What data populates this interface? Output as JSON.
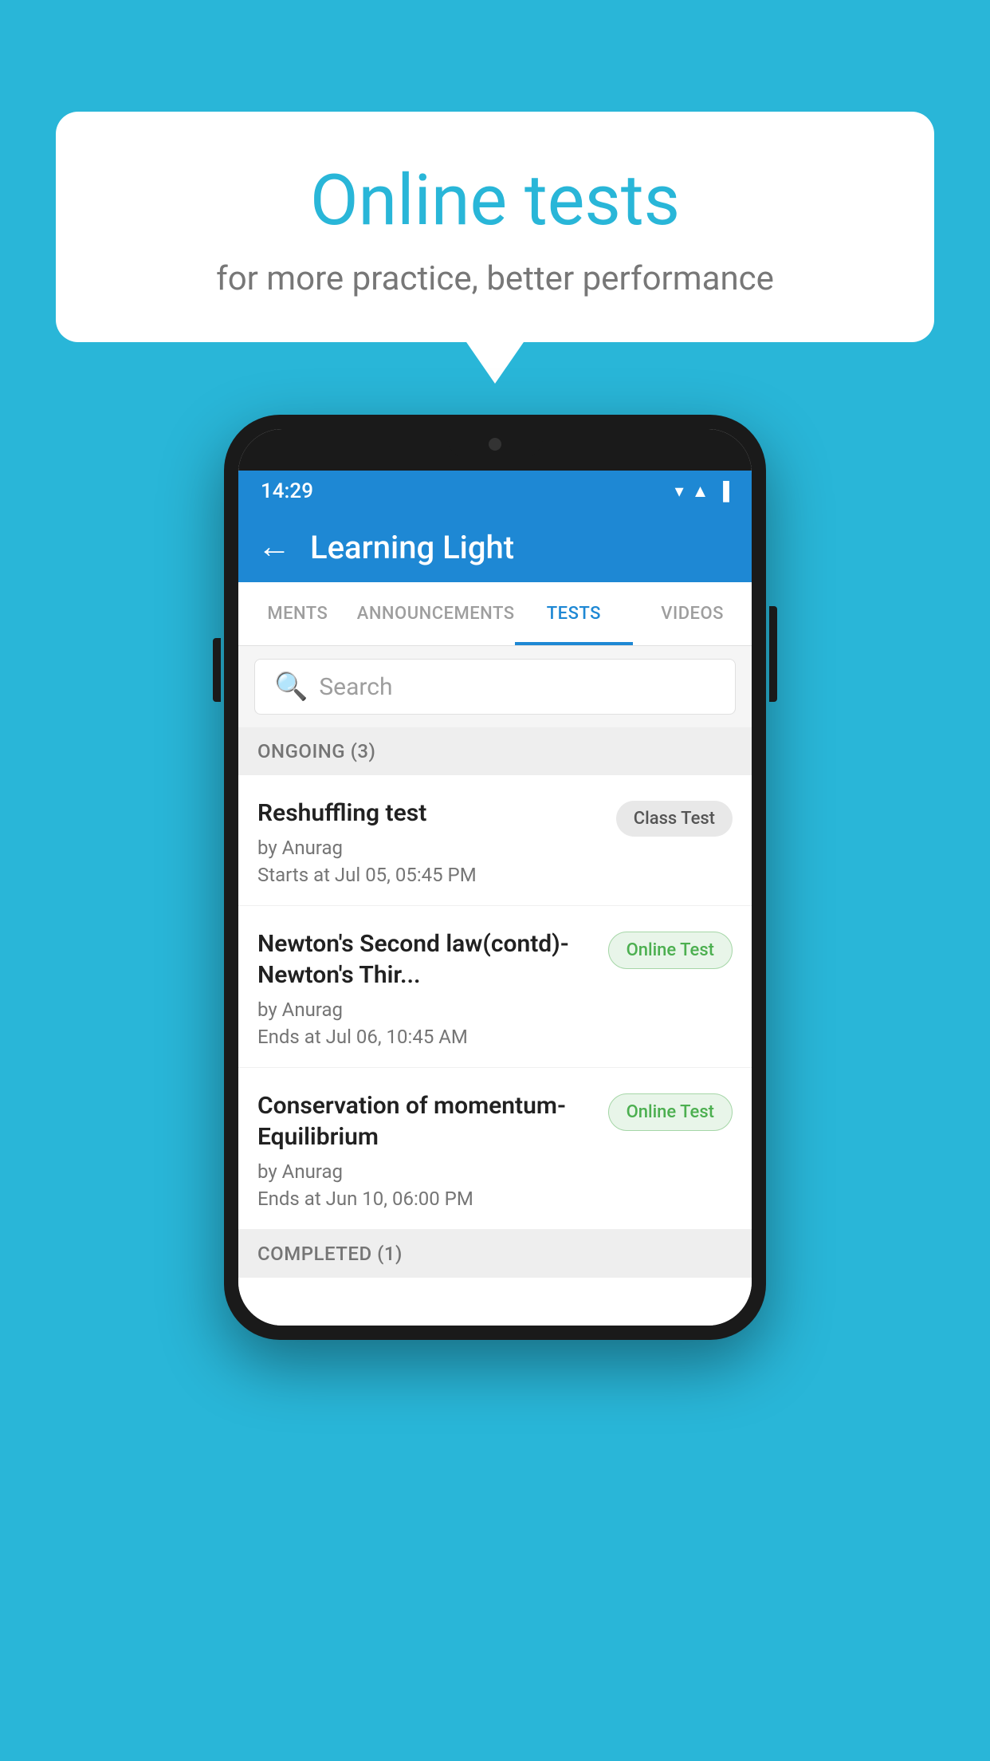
{
  "background": {
    "color": "#29b6d8"
  },
  "speech_bubble": {
    "title": "Online tests",
    "subtitle": "for more practice, better performance"
  },
  "phone": {
    "status_bar": {
      "time": "14:29",
      "wifi": "▼",
      "signal": "▲",
      "battery": "▐"
    },
    "app_bar": {
      "title": "Learning Light",
      "back_label": "←"
    },
    "tabs": [
      {
        "label": "MENTS",
        "active": false
      },
      {
        "label": "ANNOUNCEMENTS",
        "active": false
      },
      {
        "label": "TESTS",
        "active": true
      },
      {
        "label": "VIDEOS",
        "active": false
      }
    ],
    "search": {
      "placeholder": "Search"
    },
    "ongoing_section": {
      "label": "ONGOING (3)"
    },
    "tests": [
      {
        "name": "Reshuffling test",
        "author": "by Anurag",
        "date": "Starts at  Jul 05, 05:45 PM",
        "badge": "Class Test",
        "badge_type": "class"
      },
      {
        "name": "Newton's Second law(contd)-Newton's Thir...",
        "author": "by Anurag",
        "date": "Ends at  Jul 06, 10:45 AM",
        "badge": "Online Test",
        "badge_type": "online"
      },
      {
        "name": "Conservation of momentum-Equilibrium",
        "author": "by Anurag",
        "date": "Ends at  Jun 10, 06:00 PM",
        "badge": "Online Test",
        "badge_type": "online"
      }
    ],
    "completed_section": {
      "label": "COMPLETED (1)"
    }
  }
}
